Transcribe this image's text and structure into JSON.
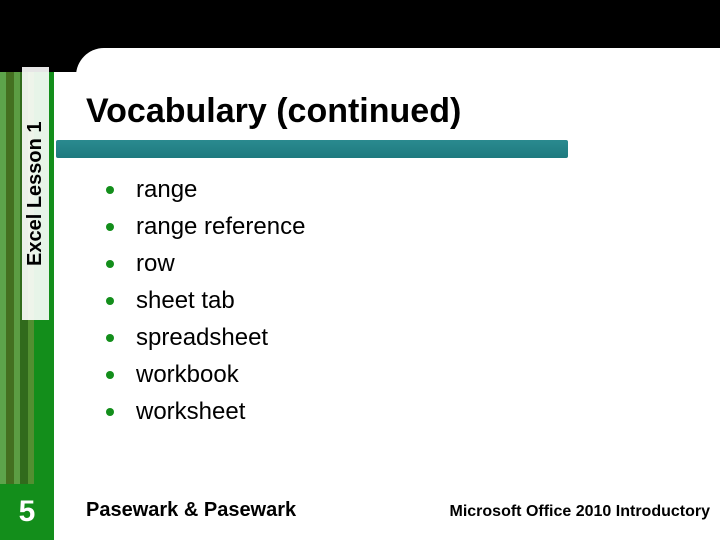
{
  "colors": {
    "green": "#138e1b",
    "teal": "#257f84",
    "black": "#000000"
  },
  "sidebar": {
    "label": "Excel Lesson 1",
    "page_number": "5"
  },
  "title": "Vocabulary (continued)",
  "bullets": [
    "range",
    "range reference",
    "row",
    "sheet tab",
    "spreadsheet",
    "workbook",
    "worksheet"
  ],
  "footer": {
    "left": "Pasewark & Pasewark",
    "right": "Microsoft Office 2010 Introductory"
  }
}
